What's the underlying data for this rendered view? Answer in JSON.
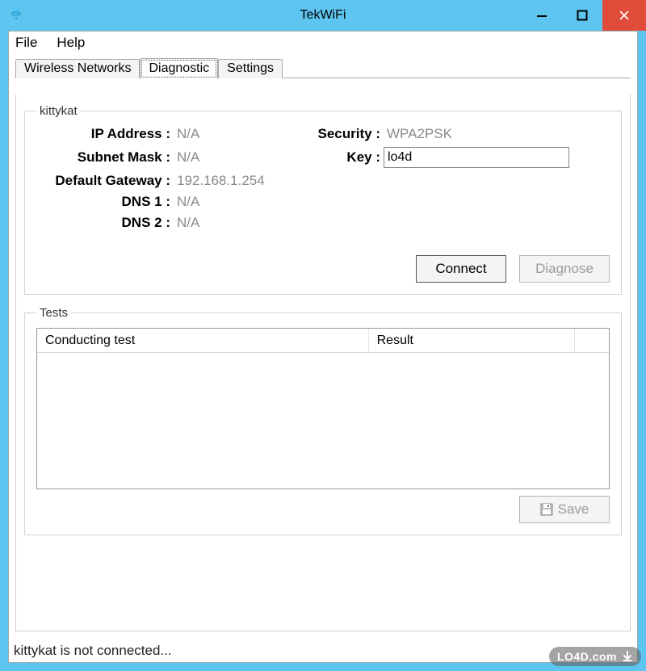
{
  "window": {
    "title": "TekWiFi"
  },
  "menu": {
    "file": "File",
    "help": "Help"
  },
  "tabs": {
    "wireless": "Wireless Networks",
    "diagnostic": "Diagnostic",
    "settings": "Settings"
  },
  "diag": {
    "group_label": "kittykat",
    "ip_label": "IP Address :",
    "ip_value": "N/A",
    "subnet_label": "Subnet Mask :",
    "subnet_value": "N/A",
    "gateway_label": "Default Gateway :",
    "gateway_value": "192.168.1.254",
    "dns1_label": "DNS 1 :",
    "dns1_value": "N/A",
    "dns2_label": "DNS 2 :",
    "dns2_value": "N/A",
    "security_label": "Security :",
    "security_value": "WPA2PSK",
    "key_label": "Key :",
    "key_value": "lo4d",
    "connect": "Connect",
    "diagnose": "Diagnose"
  },
  "tests": {
    "group_label": "Tests",
    "col_conducting": "Conducting test",
    "col_result": "Result",
    "save": "Save"
  },
  "status": {
    "text": "kittykat is not connected..."
  },
  "watermark": {
    "text": "LO4D.com"
  }
}
